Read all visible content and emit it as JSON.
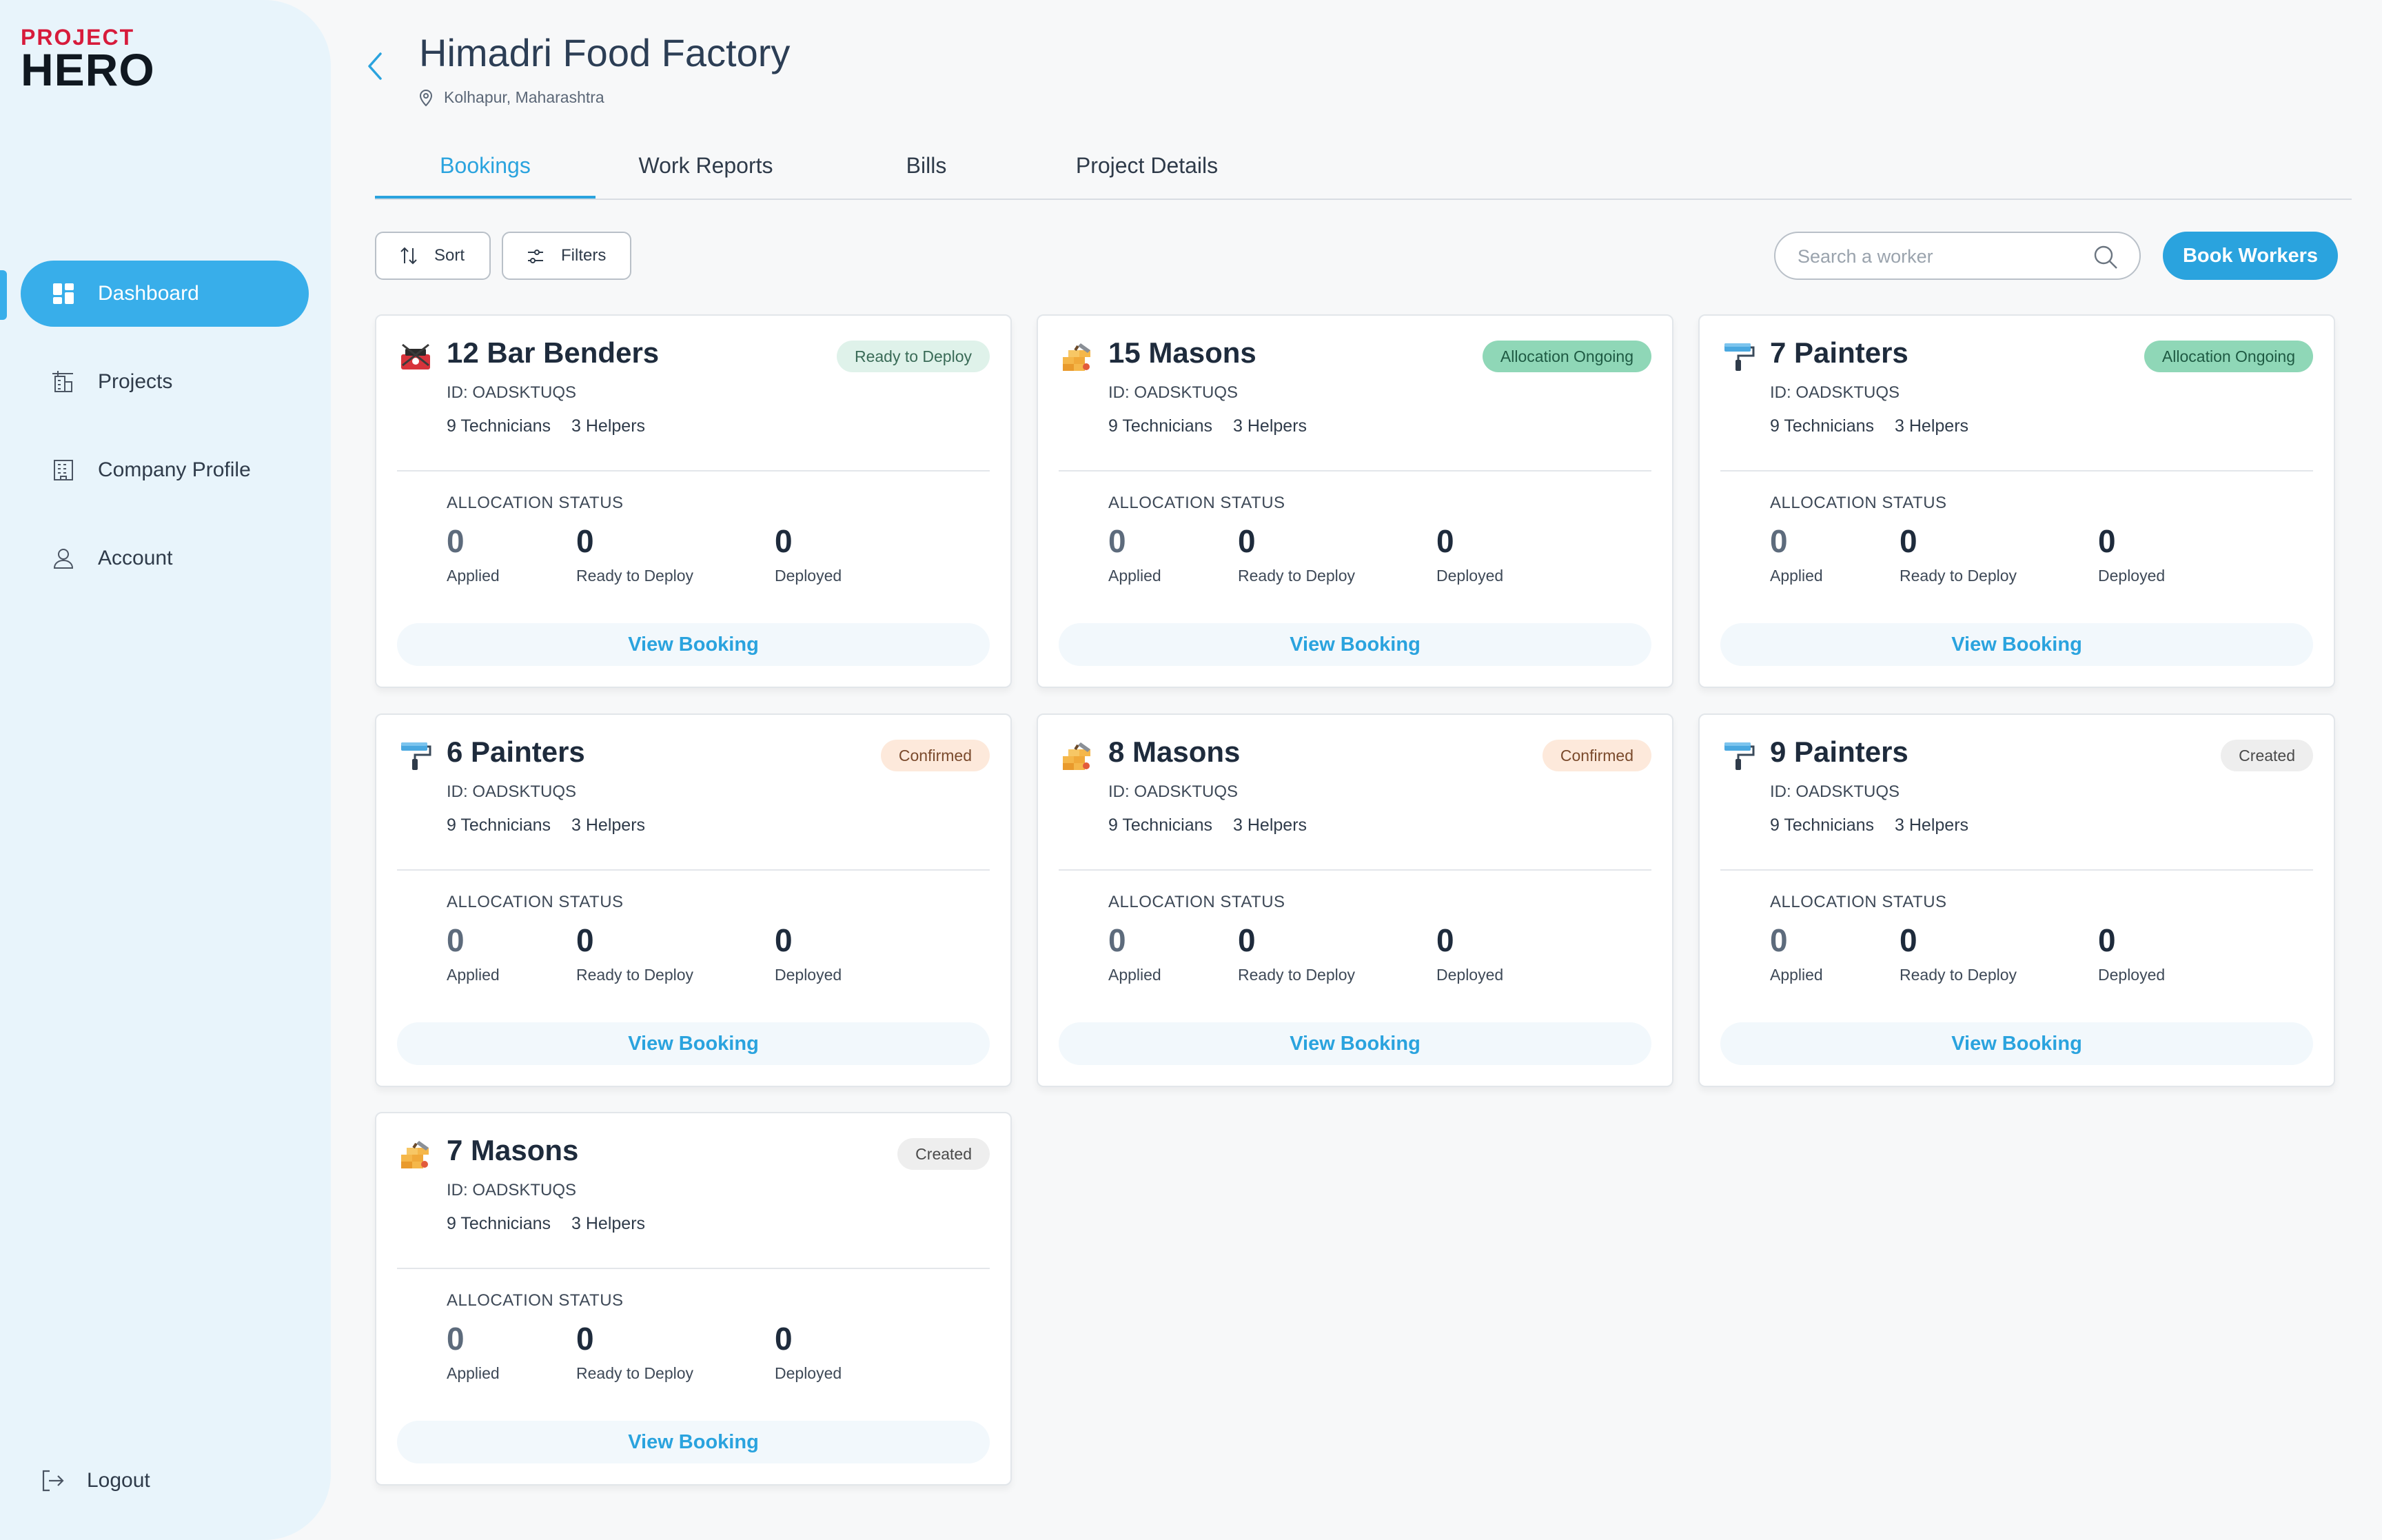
{
  "brand": {
    "line1": "PROJECT",
    "line2": "HERO"
  },
  "sidebar": {
    "items": [
      {
        "label": "Dashboard",
        "icon": "dashboard-icon",
        "active": true
      },
      {
        "label": "Projects",
        "icon": "projects-icon"
      },
      {
        "label": "Company Profile",
        "icon": "company-icon"
      },
      {
        "label": "Account",
        "icon": "account-icon"
      }
    ],
    "logout": "Logout"
  },
  "header": {
    "title": "Himadri Food Factory",
    "location": "Kolhapur, Maharashtra"
  },
  "tabs": [
    "Bookings",
    "Work Reports",
    "Bills",
    "Project Details"
  ],
  "active_tab": "Bookings",
  "toolbar": {
    "sort": "Sort",
    "filters": "Filters",
    "search_placeholder": "Search a worker",
    "book": "Book Workers"
  },
  "colors": {
    "accent": "#2aa3de",
    "sidebar_bg": "#e8f4fb",
    "brand_red": "#d71b3b"
  },
  "card_text": {
    "alloc_label": "ALLOCATION STATUS",
    "applied": "Applied",
    "ready": "Ready to Deploy",
    "deployed": "Deployed",
    "view": "View Booking"
  },
  "bookings": [
    {
      "title": "12 Bar Benders",
      "icon": "bar-bender-icon",
      "id": "ID: OADSKTUQS",
      "technicians": "9 Technicians",
      "helpers": "3 Helpers",
      "status": "Ready to Deploy",
      "status_type": "ready",
      "applied": "0",
      "ready": "0",
      "deployed": "0"
    },
    {
      "title": "15 Masons",
      "icon": "mason-icon",
      "id": "ID: OADSKTUQS",
      "technicians": "9 Technicians",
      "helpers": "3 Helpers",
      "status": "Allocation Ongoing",
      "status_type": "alloc",
      "applied": "0",
      "ready": "0",
      "deployed": "0"
    },
    {
      "title": "7 Painters",
      "icon": "painter-icon",
      "id": "ID: OADSKTUQS",
      "technicians": "9 Technicians",
      "helpers": "3 Helpers",
      "status": "Allocation Ongoing",
      "status_type": "alloc",
      "applied": "0",
      "ready": "0",
      "deployed": "0"
    },
    {
      "title": "6 Painters",
      "icon": "painter-icon",
      "id": "ID: OADSKTUQS",
      "technicians": "9 Technicians",
      "helpers": "3 Helpers",
      "status": "Confirmed",
      "status_type": "confirmed",
      "applied": "0",
      "ready": "0",
      "deployed": "0"
    },
    {
      "title": "8 Masons",
      "icon": "mason-icon",
      "id": "ID: OADSKTUQS",
      "technicians": "9 Technicians",
      "helpers": "3 Helpers",
      "status": "Confirmed",
      "status_type": "confirmed",
      "applied": "0",
      "ready": "0",
      "deployed": "0"
    },
    {
      "title": "9 Painters",
      "icon": "painter-icon",
      "id": "ID: OADSKTUQS",
      "technicians": "9 Technicians",
      "helpers": "3 Helpers",
      "status": "Created",
      "status_type": "created",
      "applied": "0",
      "ready": "0",
      "deployed": "0"
    },
    {
      "title": "7 Masons",
      "icon": "mason-icon",
      "id": "ID: OADSKTUQS",
      "technicians": "9 Technicians",
      "helpers": "3 Helpers",
      "status": "Created",
      "status_type": "created",
      "applied": "0",
      "ready": "0",
      "deployed": "0"
    }
  ]
}
